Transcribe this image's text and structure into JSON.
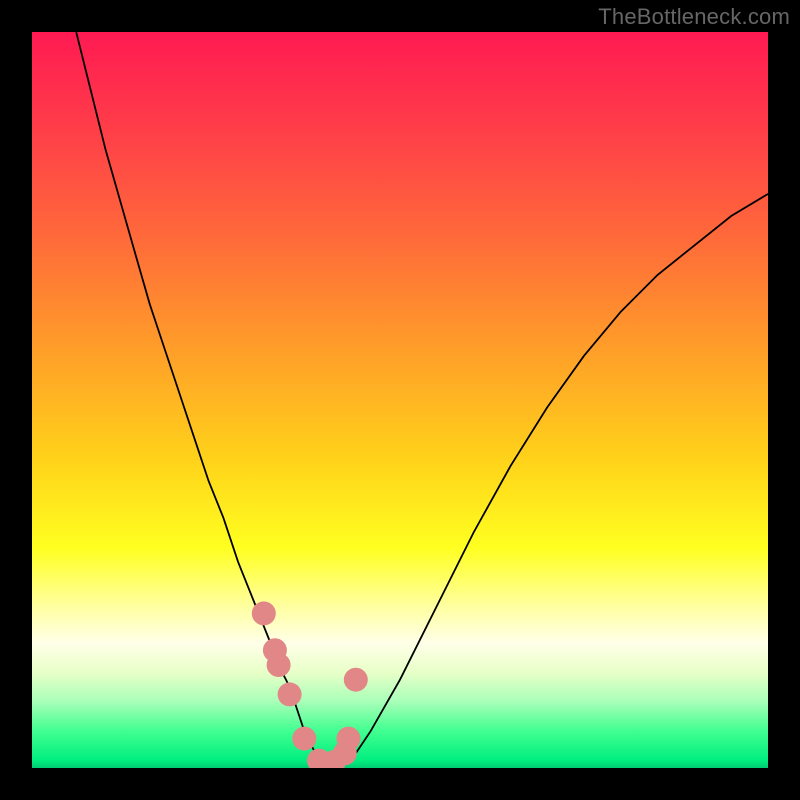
{
  "watermark": "TheBottleneck.com",
  "chart_data": {
    "type": "line",
    "title": "",
    "xlabel": "",
    "ylabel": "",
    "xlim": [
      0,
      100
    ],
    "ylim": [
      0,
      100
    ],
    "series": [
      {
        "name": "bottleneck-curve",
        "x": [
          6,
          8,
          10,
          12,
          14,
          16,
          18,
          20,
          22,
          24,
          26,
          28,
          30,
          32,
          34,
          35,
          36,
          37,
          38,
          39,
          40,
          42,
          44,
          46,
          50,
          55,
          60,
          65,
          70,
          75,
          80,
          85,
          90,
          95,
          100
        ],
        "values": [
          100,
          92,
          84,
          77,
          70,
          63,
          57,
          51,
          45,
          39,
          34,
          28,
          23,
          18,
          13,
          11,
          8,
          5,
          3,
          1,
          0.5,
          0.5,
          2,
          5,
          12,
          22,
          32,
          41,
          49,
          56,
          62,
          67,
          71,
          75,
          78
        ]
      }
    ],
    "markers": {
      "name": "highlight-points",
      "color": "#e28787",
      "x": [
        31.5,
        33,
        33.5,
        35,
        37,
        39,
        41,
        42.5,
        43,
        44
      ],
      "values": [
        21,
        16,
        14,
        10,
        4,
        1,
        0.8,
        2,
        4,
        12
      ]
    },
    "background_gradient": {
      "top": "#ff1a52",
      "mid": "#ffff20",
      "bottom": "#00ee80"
    }
  }
}
